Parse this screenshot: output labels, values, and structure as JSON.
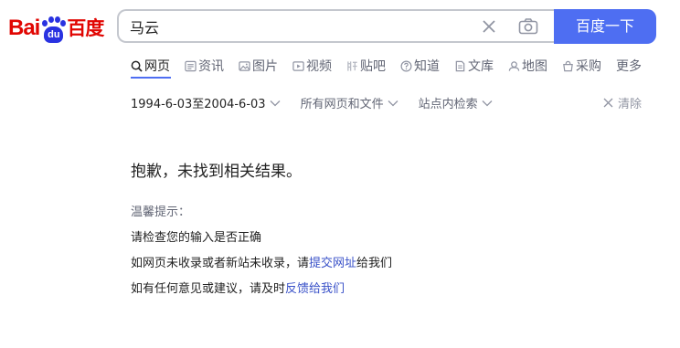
{
  "logo": {
    "part1": "Bai",
    "paw_text": "du",
    "part2": "百度"
  },
  "search": {
    "query": "马云",
    "button_label": "百度一下"
  },
  "tabs": [
    {
      "label": "网页",
      "icon": "search-icon"
    },
    {
      "label": "资讯",
      "icon": "news-icon"
    },
    {
      "label": "图片",
      "icon": "image-icon"
    },
    {
      "label": "视频",
      "icon": "video-icon"
    },
    {
      "label": "贴吧",
      "icon": "tieba-icon"
    },
    {
      "label": "知道",
      "icon": "question-icon"
    },
    {
      "label": "文库",
      "icon": "document-icon"
    },
    {
      "label": "地图",
      "icon": "map-icon"
    },
    {
      "label": "采购",
      "icon": "cart-icon"
    },
    {
      "label": "更多",
      "icon": ""
    }
  ],
  "filters": {
    "time": "1994-6-03至2004-6-03",
    "filetype": "所有网页和文件",
    "site": "站点内检索",
    "clear": "清除"
  },
  "result": {
    "message": "抱歉，未找到相关结果。",
    "tips_title": "温馨提示：",
    "tip1": "请检查您的输入是否正确",
    "tip2_prefix": "如网页未收录或者新站未收录，请",
    "tip2_link": "提交网址",
    "tip2_suffix": "给我们",
    "tip3_prefix": "如有任何意见或建议，请及时",
    "tip3_link": "反馈给我们"
  },
  "colors": {
    "brand_blue": "#4e6ef2",
    "logo_red": "#e10602",
    "logo_blue": "#2932e1",
    "link": "#3951c8"
  }
}
